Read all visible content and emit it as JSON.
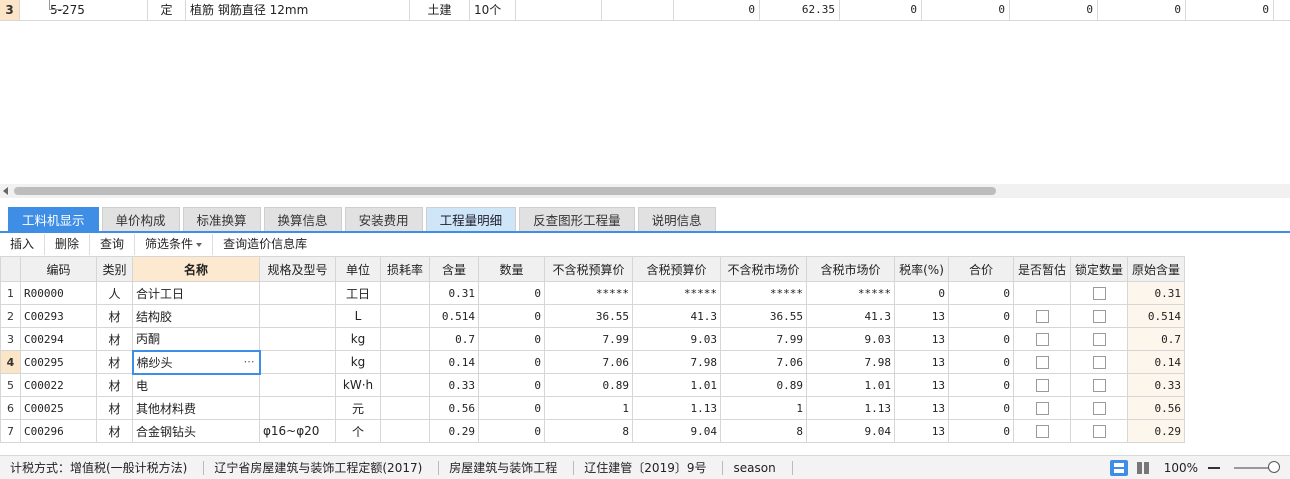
{
  "top_row": {
    "row_number": "3",
    "code": "5-275",
    "type": "定",
    "name": "植筋 钢筋直径 12mm",
    "specialty": "土建",
    "unit": "10个",
    "values": [
      "0",
      "62.35",
      "0",
      "0",
      "0",
      "0",
      "0"
    ]
  },
  "tabs": [
    {
      "label": "工料机显示",
      "state": "active"
    },
    {
      "label": "单价构成",
      "state": "normal"
    },
    {
      "label": "标准换算",
      "state": "normal"
    },
    {
      "label": "换算信息",
      "state": "normal"
    },
    {
      "label": "安装费用",
      "state": "normal"
    },
    {
      "label": "工程量明细",
      "state": "soft"
    },
    {
      "label": "反查图形工程量",
      "state": "normal"
    },
    {
      "label": "说明信息",
      "state": "normal"
    }
  ],
  "toolbar": {
    "insert": "插入",
    "delete": "删除",
    "query": "查询",
    "filter": "筛选条件",
    "price_query": "查询造价信息库"
  },
  "columns": [
    "编码",
    "类别",
    "名称",
    "规格及型号",
    "单位",
    "损耗率",
    "含量",
    "数量",
    "不含税预算价",
    "含税预算价",
    "不含税市场价",
    "含税市场价",
    "税率(%)",
    "合价",
    "是否暂估",
    "锁定数量",
    "原始含量"
  ],
  "rows": [
    {
      "n": "1",
      "code": "R00000",
      "cat": "人",
      "name": "合计工日",
      "spec": "",
      "unit": "工日",
      "loss": "",
      "qty": "0.31",
      "num": "0",
      "p1": "*****",
      "p2": "*****",
      "p3": "*****",
      "p4": "*****",
      "tax": "0",
      "total": "0",
      "est": false,
      "lock": true,
      "orig": "0.31"
    },
    {
      "n": "2",
      "code": "C00293",
      "cat": "材",
      "name": "结构胶",
      "spec": "",
      "unit": "L",
      "loss": "",
      "qty": "0.514",
      "num": "0",
      "p1": "36.55",
      "p2": "41.3",
      "p3": "36.55",
      "p4": "41.3",
      "tax": "13",
      "total": "0",
      "est": true,
      "lock": true,
      "orig": "0.514"
    },
    {
      "n": "3",
      "code": "C00294",
      "cat": "材",
      "name": "丙酮",
      "spec": "",
      "unit": "kg",
      "loss": "",
      "qty": "0.7",
      "num": "0",
      "p1": "7.99",
      "p2": "9.03",
      "p3": "7.99",
      "p4": "9.03",
      "tax": "13",
      "total": "0",
      "est": true,
      "lock": true,
      "orig": "0.7"
    },
    {
      "n": "4",
      "code": "C00295",
      "cat": "材",
      "name": "棉纱头",
      "spec": "",
      "unit": "kg",
      "loss": "",
      "qty": "0.14",
      "num": "0",
      "p1": "7.06",
      "p2": "7.98",
      "p3": "7.06",
      "p4": "7.98",
      "tax": "13",
      "total": "0",
      "est": true,
      "lock": true,
      "orig": "0.14"
    },
    {
      "n": "5",
      "code": "C00022",
      "cat": "材",
      "name": "电",
      "spec": "",
      "unit": "kW·h",
      "loss": "",
      "qty": "0.33",
      "num": "0",
      "p1": "0.89",
      "p2": "1.01",
      "p3": "0.89",
      "p4": "1.01",
      "tax": "13",
      "total": "0",
      "est": true,
      "lock": true,
      "orig": "0.33"
    },
    {
      "n": "6",
      "code": "C00025",
      "cat": "材",
      "name": "其他材料费",
      "spec": "",
      "unit": "元",
      "loss": "",
      "qty": "0.56",
      "num": "0",
      "p1": "1",
      "p2": "1.13",
      "p3": "1",
      "p4": "1.13",
      "tax": "13",
      "total": "0",
      "est": true,
      "lock": true,
      "orig": "0.56"
    },
    {
      "n": "7",
      "code": "C00296",
      "cat": "材",
      "name": "合金钢钻头",
      "spec": "φ16~φ20",
      "unit": "个",
      "loss": "",
      "qty": "0.29",
      "num": "0",
      "p1": "8",
      "p2": "9.04",
      "p3": "8",
      "p4": "9.04",
      "tax": "13",
      "total": "0",
      "est": true,
      "lock": true,
      "orig": "0.29"
    }
  ],
  "selected_row": "4",
  "status": {
    "tax_method": "计税方式：增值税(一般计税方法)",
    "quota": "辽宁省房屋建筑与装饰工程定额(2017)",
    "specialty": "房屋建筑与装饰工程",
    "document": "辽住建管〔2019〕9号",
    "user": "season",
    "zoom": "100%"
  }
}
